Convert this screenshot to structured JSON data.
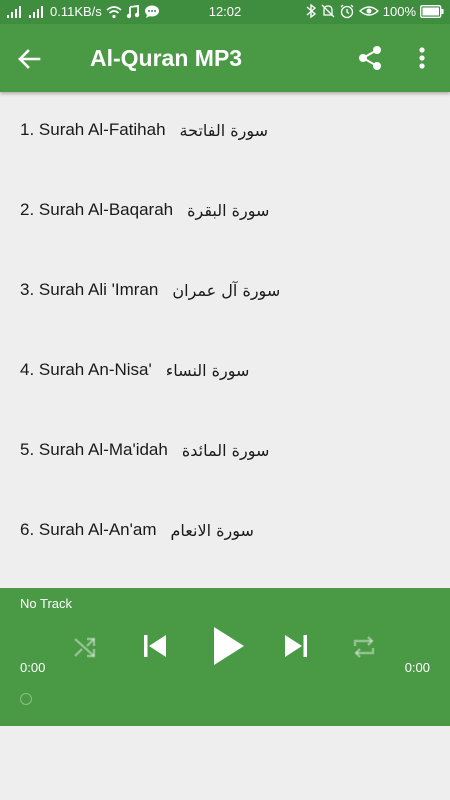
{
  "status_bar": {
    "speed": "0.11KB/s",
    "time": "12:02",
    "battery": "100%"
  },
  "app_bar": {
    "title": "Al-Quran MP3",
    "icons": [
      "arrow-back-icon",
      "share-icon",
      "more-vert-icon"
    ]
  },
  "surahs": [
    {
      "name": "1. Surah Al-Fatihah",
      "arabic": "سورة الفاتحة"
    },
    {
      "name": "2. Surah Al-Baqarah",
      "arabic": "سورة البقرة"
    },
    {
      "name": "3. Surah Ali 'Imran",
      "arabic": "سورة آل عمران"
    },
    {
      "name": "4. Surah An-Nisa'",
      "arabic": "سورة النساء"
    },
    {
      "name": "5. Surah Al-Ma'idah",
      "arabic": "سورة المائدة"
    },
    {
      "name": "6. Surah Al-An'am",
      "arabic": "سورة الانعام"
    }
  ],
  "player": {
    "track": "No Track",
    "elapsed": "0:00",
    "duration": "0:00",
    "progress": 0,
    "icons": [
      "shuffle-icon",
      "skip-previous-icon",
      "play-icon",
      "skip-next-icon",
      "repeat-icon"
    ]
  },
  "colors": {
    "status_bar": "#3f8e3f",
    "primary": "#4a9a45",
    "background": "#eeeeee",
    "text": "#1a1a1a"
  }
}
